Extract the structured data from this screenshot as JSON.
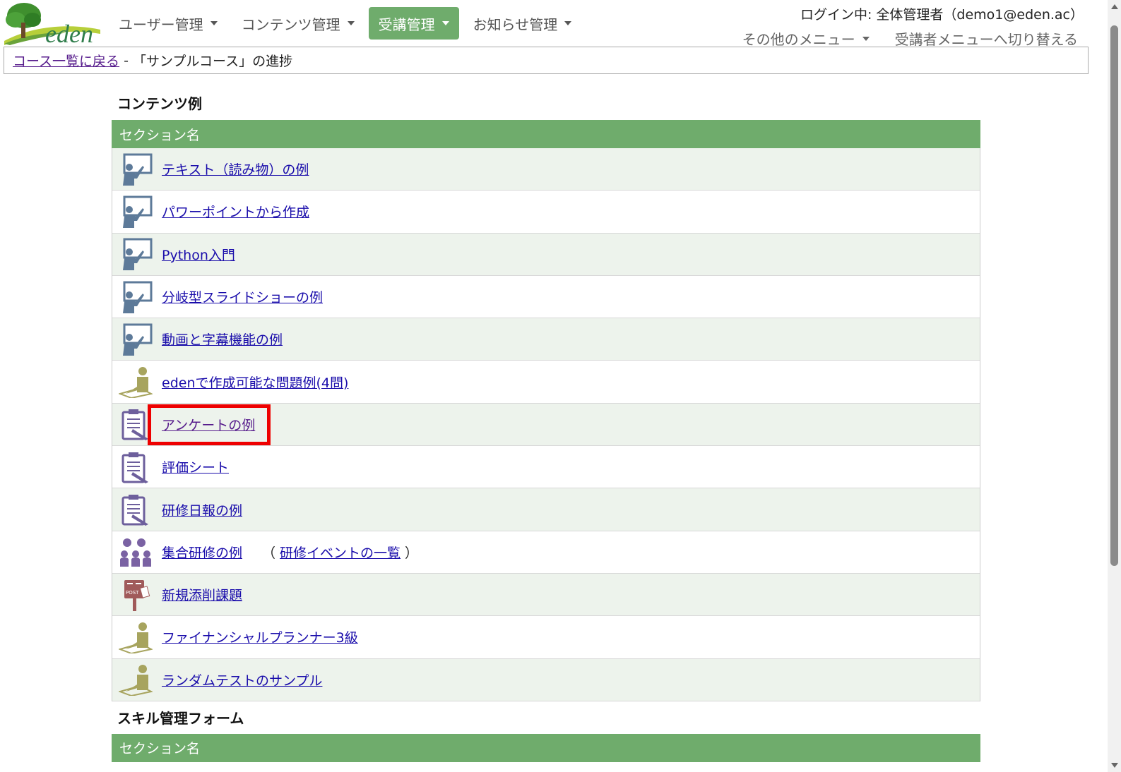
{
  "brand": {
    "logo_text": "eden"
  },
  "nav": [
    {
      "label": "ユーザー管理",
      "active": false
    },
    {
      "label": "コンテンツ管理",
      "active": false
    },
    {
      "label": "受講管理",
      "active": true
    },
    {
      "label": "お知らせ管理",
      "active": false
    }
  ],
  "user": {
    "login_label": "ログイン中: 全体管理者（demo1@eden.ac）"
  },
  "sub_menu": {
    "other_menu": "その他のメニュー",
    "switch_menu": "受講者メニューへ切り替える"
  },
  "breadcrumb": {
    "back_link": "コース一覧に戻る",
    "separator": " - ",
    "current": "「サンプルコース」の進捗"
  },
  "sections": [
    {
      "title": "コンテンツ例",
      "header": "セクション名",
      "items": [
        {
          "label": "テキスト（読み物）の例",
          "icon": "lecture-icon"
        },
        {
          "label": "パワーポイントから作成",
          "icon": "lecture-icon"
        },
        {
          "label": "Python入門",
          "icon": "lecture-icon"
        },
        {
          "label": "分岐型スライドショーの例",
          "icon": "lecture-icon"
        },
        {
          "label": "動画と字幕機能の例",
          "icon": "lecture-icon"
        },
        {
          "label": "edenで作成可能な問題例(4問)",
          "icon": "test-icon"
        },
        {
          "label": "アンケートの例",
          "icon": "clipboard-icon"
        },
        {
          "label": "評価シート",
          "icon": "clipboard-icon"
        },
        {
          "label": "研修日報の例",
          "icon": "clipboard-icon"
        },
        {
          "label": "集合研修の例",
          "icon": "group-training-icon",
          "extra_open": "（",
          "extra_link": "研修イベントの一覧",
          "extra_close": "）"
        },
        {
          "label": "新規添削課題",
          "icon": "post-icon"
        },
        {
          "label": "ファイナンシャルプランナー3級",
          "icon": "test-icon"
        },
        {
          "label": "ランダムテストのサンプル",
          "icon": "test-icon"
        }
      ]
    },
    {
      "title": "スキル管理フォーム",
      "header": "セクション名"
    }
  ],
  "colors": {
    "accent": "#6fac6c",
    "row_alt": "#edf3ec",
    "link": "#1a0dab",
    "highlight": "#e00000"
  }
}
